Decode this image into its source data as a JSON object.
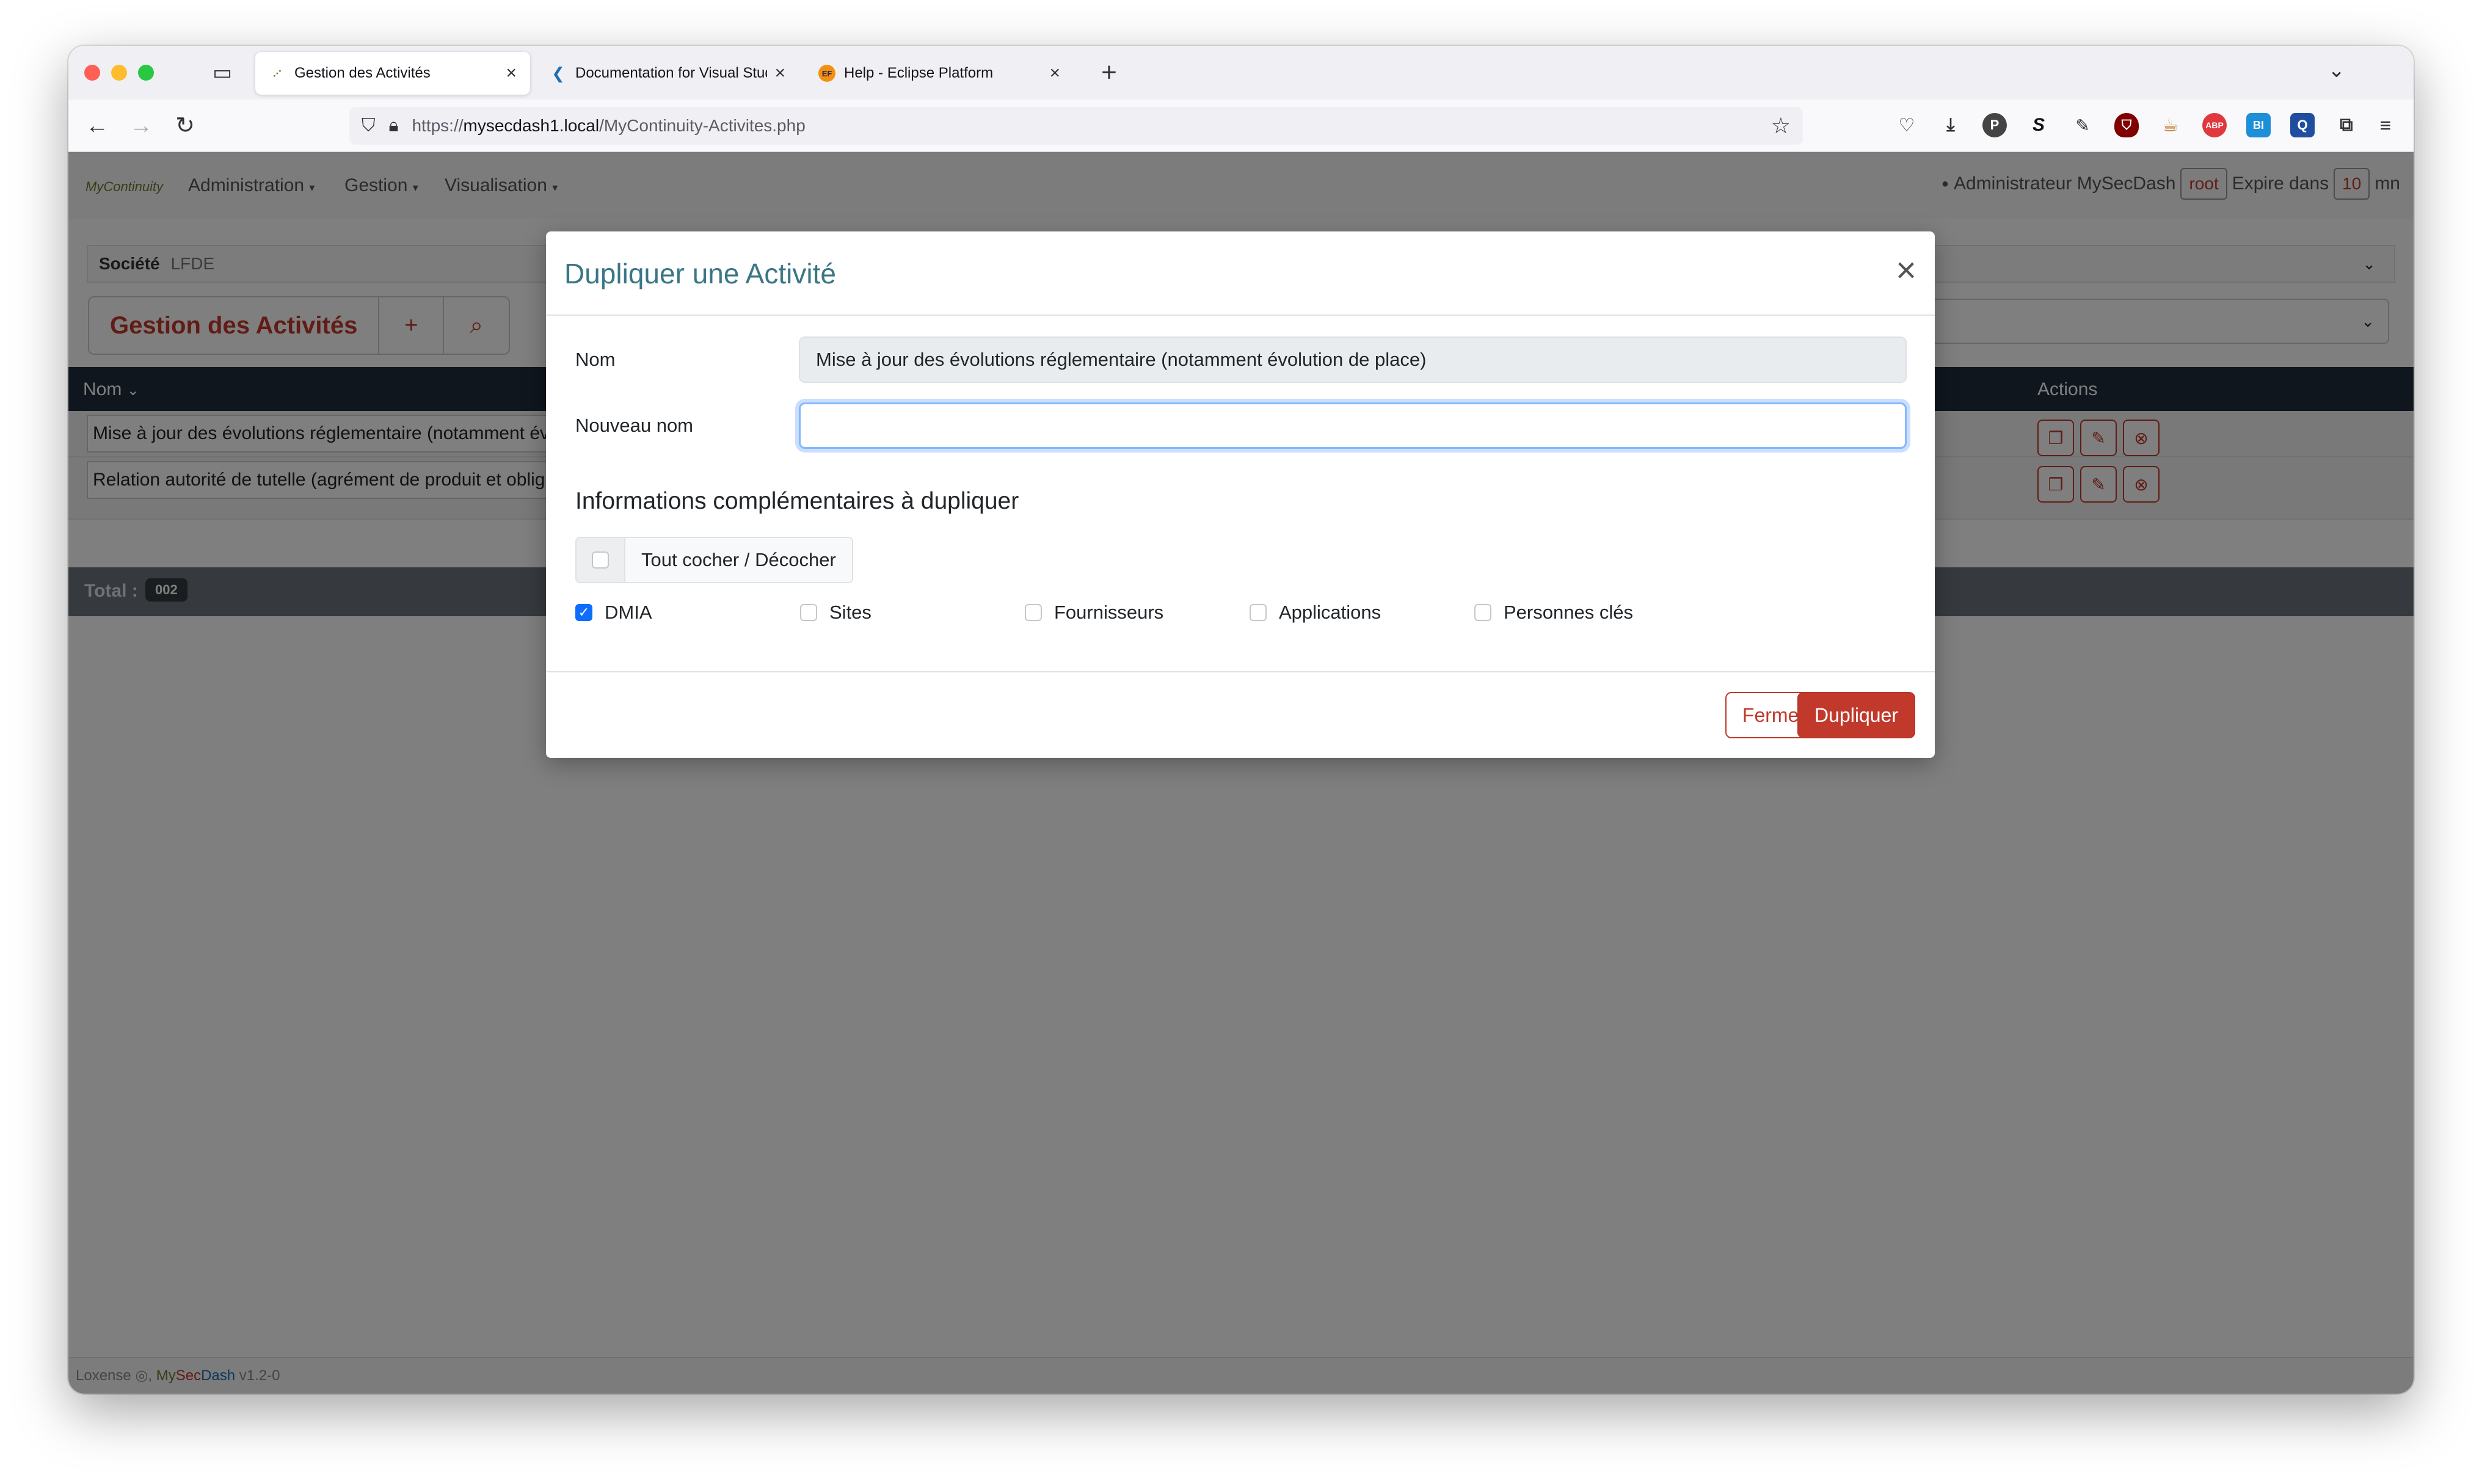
{
  "browser": {
    "tabs": [
      {
        "title": "Gestion des Activités",
        "active": true
      },
      {
        "title": "Documentation for Visual Studio Code",
        "active": false
      },
      {
        "title": "Help - Eclipse Platform",
        "active": false
      }
    ],
    "url_scheme": "https://",
    "url_host": "mysecdash1.local",
    "url_path": "/MyContinuity-Activites.php",
    "ext_labels": {
      "ublock": "",
      "abp": "ABP",
      "bi": "BI",
      "q": "Q",
      "p": "P",
      "s": "S"
    }
  },
  "app": {
    "logo_text": "MyContinuity",
    "menu": [
      "Administration",
      "Gestion",
      "Visualisation"
    ],
    "user": {
      "name": "Administrateur MySecDash",
      "login": "root",
      "expire_label": "Expire dans",
      "expire_value": "10",
      "expire_unit": "mn"
    },
    "societe": {
      "label": "Société",
      "value": "LFDE"
    },
    "page_title": "Gestion des Activités",
    "table": {
      "columns": {
        "nom": "Nom",
        "actions": "Actions"
      },
      "rows": [
        {
          "nom": "Mise à jour des évolutions réglementaire (notamment évolution de place)"
        },
        {
          "nom": "Relation autorité de tutelle (agrément de produit et obligations légales)"
        }
      ],
      "total_label": "Total :",
      "total_value": "002"
    },
    "footer": {
      "company": "Loxense",
      "brand_my": "My",
      "brand_sec": "Sec",
      "brand_dash": "Dash",
      "version": "v1.2-0"
    }
  },
  "modal": {
    "title": "Dupliquer une Activité",
    "nom_label": "Nom",
    "nom_value": "Mise à jour des évolutions réglementaire (notamment évolution de place)",
    "nouveau_nom_label": "Nouveau nom",
    "nouveau_nom_value": "",
    "subheading": "Informations complémentaires à dupliquer",
    "toggle_all_label": "Tout cocher / Décocher",
    "options": [
      {
        "label": "DMIA",
        "checked": true
      },
      {
        "label": "Sites",
        "checked": false
      },
      {
        "label": "Fournisseurs",
        "checked": false
      },
      {
        "label": "Applications",
        "checked": false
      },
      {
        "label": "Personnes clés",
        "checked": false
      }
    ],
    "close_button": "Fermer",
    "duplicate_button": "Dupliquer"
  },
  "colors": {
    "accent_red": "#c0392b",
    "modal_title": "#3a7686",
    "checkbox_blue": "#0d6efd",
    "table_header": "#1f2d3d"
  }
}
